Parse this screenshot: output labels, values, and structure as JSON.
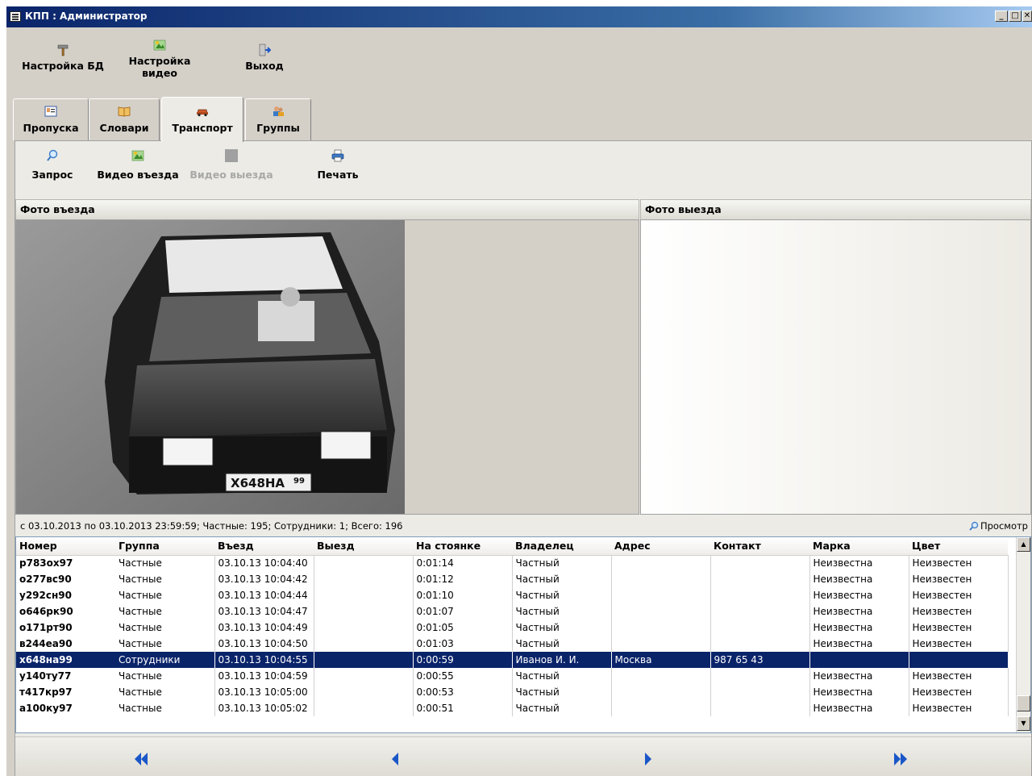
{
  "window": {
    "title": "КПП : Администратор",
    "controls": {
      "minimize": "_",
      "maximize": "□",
      "close": "✕"
    }
  },
  "main_toolbar": {
    "db_settings": "Настройка БД",
    "video_settings": "Настройка видео",
    "exit": "Выход"
  },
  "tabs": [
    {
      "label": "Пропуска"
    },
    {
      "label": "Словари"
    },
    {
      "label": "Транспорт",
      "active": true
    },
    {
      "label": "Группы"
    }
  ],
  "transport_toolbar": {
    "query": "Запрос",
    "video_entry": "Видео въезда",
    "video_exit": "Видео выезда",
    "print": "Печать"
  },
  "photos": {
    "entry_title": "Фото въезда",
    "exit_title": "Фото выезда",
    "plate_text": "Х648НА",
    "plate_region": "99"
  },
  "status": {
    "summary": "с 03.10.2013 по 03.10.2013 23:59:59; Частные: 195;  Сотрудники: 1;  Всего: 196",
    "view_button": "Просмотр"
  },
  "grid": {
    "columns": [
      "Номер",
      "Группа",
      "Въезд",
      "Выезд",
      "На стоянке",
      "Владелец",
      "Адрес",
      "Контакт",
      "Марка",
      "Цвет"
    ],
    "rows": [
      [
        "р783ох97",
        "Частные",
        "03.10.13 10:04:40",
        "",
        "0:01:14",
        "Частный",
        "",
        "",
        "Неизвестна",
        "Неизвестен"
      ],
      [
        "о277вс90",
        "Частные",
        "03.10.13 10:04:42",
        "",
        "0:01:12",
        "Частный",
        "",
        "",
        "Неизвестна",
        "Неизвестен"
      ],
      [
        "у292сн90",
        "Частные",
        "03.10.13 10:04:44",
        "",
        "0:01:10",
        "Частный",
        "",
        "",
        "Неизвестна",
        "Неизвестен"
      ],
      [
        "о646рк90",
        "Частные",
        "03.10.13 10:04:47",
        "",
        "0:01:07",
        "Частный",
        "",
        "",
        "Неизвестна",
        "Неизвестен"
      ],
      [
        "о171рт90",
        "Частные",
        "03.10.13 10:04:49",
        "",
        "0:01:05",
        "Частный",
        "",
        "",
        "Неизвестна",
        "Неизвестен"
      ],
      [
        "в244еа90",
        "Частные",
        "03.10.13 10:04:50",
        "",
        "0:01:03",
        "Частный",
        "",
        "",
        "Неизвестна",
        "Неизвестен"
      ],
      [
        "х648на99",
        "Сотрудники",
        "03.10.13 10:04:55",
        "",
        "0:00:59",
        "Иванов И. И.",
        "Москва",
        "987 65 43",
        "",
        ""
      ],
      [
        "у140ту77",
        "Частные",
        "03.10.13 10:04:59",
        "",
        "0:00:55",
        "Частный",
        "",
        "",
        "Неизвестна",
        "Неизвестен"
      ],
      [
        "т417кр97",
        "Частные",
        "03.10.13 10:05:00",
        "",
        "0:00:53",
        "Частный",
        "",
        "",
        "Неизвестна",
        "Неизвестен"
      ],
      [
        "а100ку97",
        "Частные",
        "03.10.13 10:05:02",
        "",
        "0:00:51",
        "Частный",
        "",
        "",
        "Неизвестна",
        "Неизвестен"
      ]
    ],
    "selected_row": 6
  },
  "icons": {
    "title": "app-icon",
    "db_settings": "hammer-icon",
    "video_settings": "video-map-icon",
    "exit": "door-exit-icon",
    "tab_passes": "id-card-icon",
    "tab_dicts": "book-icon",
    "tab_transport": "car-icon",
    "tab_groups": "people-icon",
    "query": "magnifier-icon",
    "video_entry": "video-map-icon",
    "video_exit": "gray-square-icon",
    "print": "printer-icon",
    "view": "magnifier-icon",
    "nav_first": "double-left-arrow-icon",
    "nav_prev": "left-arrow-icon",
    "nav_next": "right-arrow-icon",
    "nav_last": "double-right-arrow-icon"
  },
  "colors": {
    "title_gradient_start": "#0a246a",
    "selection": "#0a246a",
    "nav_arrows": "#1a56c8"
  }
}
